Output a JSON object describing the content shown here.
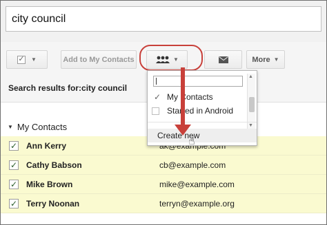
{
  "search": {
    "value": "city council"
  },
  "toolbar": {
    "select_checkbox_icon": "checkmark-icon",
    "add_to_contacts_label": "Add to My Contacts",
    "groups_icon": "people-icon",
    "mail_icon": "envelope-icon",
    "more_label": "More"
  },
  "results": {
    "title": "Search results for:city council"
  },
  "group": {
    "label": "My Contacts"
  },
  "contacts": [
    {
      "name": "Ann Kerry",
      "email": "ak@example.com"
    },
    {
      "name": "Cathy Babson",
      "email": "cb@example.com"
    },
    {
      "name": "Mike Brown",
      "email": "mike@example.com"
    },
    {
      "name": "Terry Noonan",
      "email": "terryn@example.org"
    }
  ],
  "group_menu": {
    "items": [
      {
        "label": "My Contacts",
        "checked": true
      },
      {
        "label": "Starred in Android",
        "checked": false
      }
    ],
    "create_label": "Create new"
  },
  "colors": {
    "annotation": "#c8403a",
    "row_highlight": "#fafad0",
    "band": "#f5f5f5"
  }
}
